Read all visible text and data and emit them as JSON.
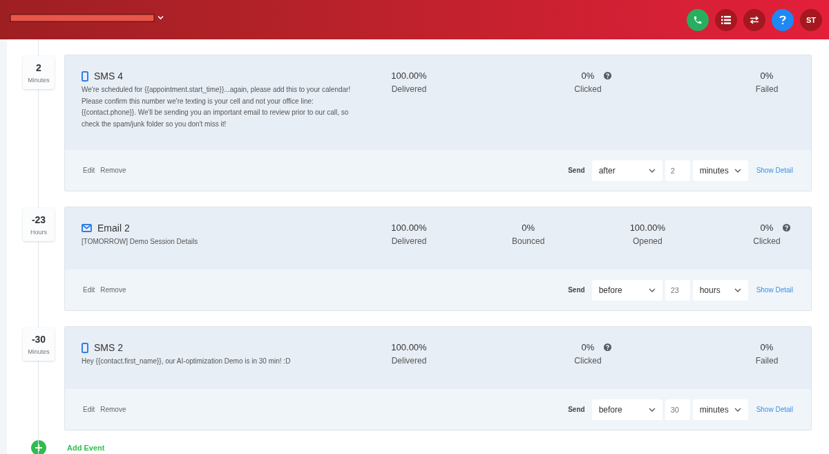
{
  "header": {
    "actions": [
      {
        "kind": "phone",
        "color": "#27ae60"
      },
      {
        "kind": "list",
        "color": "#a5181f"
      },
      {
        "kind": "swap",
        "color": "#a5181f"
      },
      {
        "kind": "help",
        "color": "#1e88f5"
      },
      {
        "kind": "avatar",
        "label": "ST",
        "color": "#a5181f"
      }
    ]
  },
  "events": [
    {
      "delay": "2",
      "unit": "Minutes",
      "kind": "sms",
      "name": "SMS 4",
      "message": "We're scheduled for {{appointment.start_time}}...again, please add this to your calendar! Please confirm this number we're texting is your cell and not your office line: {{contact.phone}}. We'll be sending you an important email to review prior to our call, so check the spam/junk folder so you don't miss it!",
      "stats": [
        {
          "value": "100.00%",
          "label": "Delivered",
          "help": false
        },
        {
          "value": "0%",
          "label": "Clicked",
          "help": true
        },
        {
          "value": "0%",
          "label": "Failed",
          "help": false
        }
      ],
      "edit": "Edit",
      "remove": "Remove",
      "send_label": "Send",
      "when": "after",
      "amount": "2",
      "amount_unit": "minutes",
      "detail": "Show Detail"
    },
    {
      "delay": "-23",
      "unit": "Hours",
      "kind": "email",
      "name": "Email 2",
      "message": "[TOMORROW] Demo Session Details",
      "stats": [
        {
          "value": "100.00%",
          "label": "Delivered",
          "help": false
        },
        {
          "value": "0%",
          "label": "Bounced",
          "help": false
        },
        {
          "value": "100.00%",
          "label": "Opened",
          "help": false
        },
        {
          "value": "0%",
          "label": "Clicked",
          "help": true
        }
      ],
      "edit": "Edit",
      "remove": "Remove",
      "send_label": "Send",
      "when": "before",
      "amount": "23",
      "amount_unit": "hours",
      "detail": "Show Detail"
    },
    {
      "delay": "-30",
      "unit": "Minutes",
      "kind": "sms",
      "name": "SMS 2",
      "message": "Hey {{contact.first_name}}, our AI-optimization Demo is in 30 min! :D",
      "stats": [
        {
          "value": "100.00%",
          "label": "Delivered",
          "help": false
        },
        {
          "value": "0%",
          "label": "Clicked",
          "help": true
        },
        {
          "value": "0%",
          "label": "Failed",
          "help": false
        }
      ],
      "edit": "Edit",
      "remove": "Remove",
      "send_label": "Send",
      "when": "before",
      "amount": "30",
      "amount_unit": "minutes",
      "detail": "Show Detail"
    }
  ],
  "add_event": "Add Event"
}
